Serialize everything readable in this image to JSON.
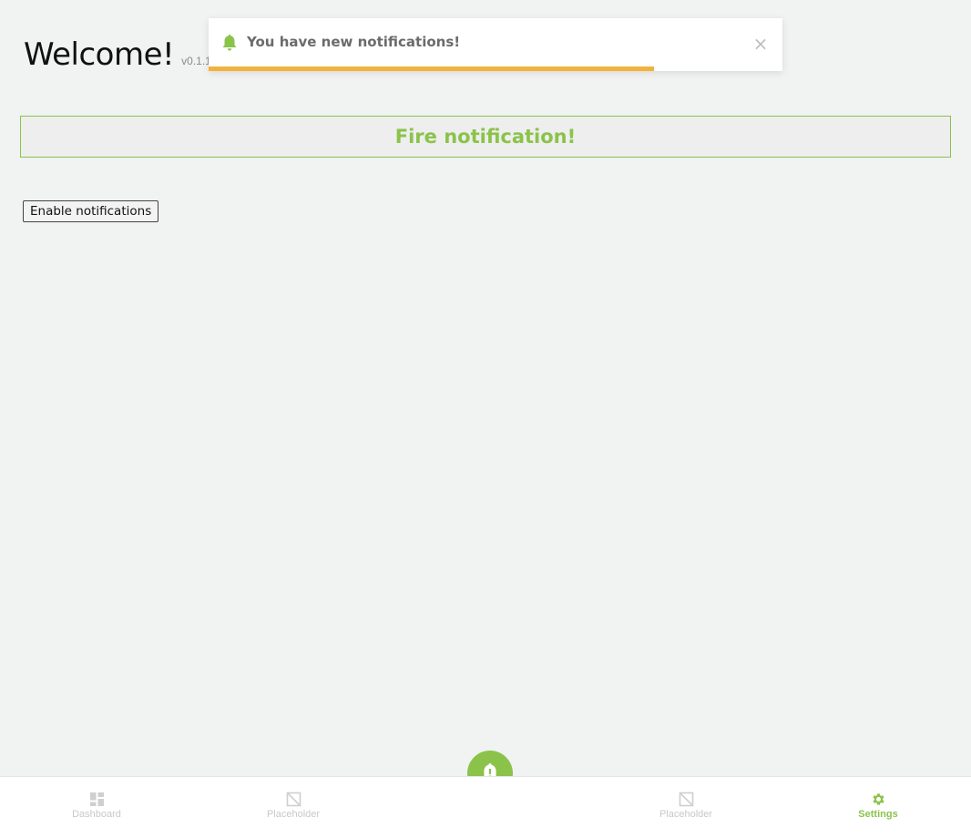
{
  "header": {
    "title": "Welcome!",
    "version": "v0.1.1"
  },
  "toast": {
    "message": "You have new notifications!",
    "icon": "bell-icon",
    "close_icon": "close-icon",
    "progress_fraction": 0.776
  },
  "main": {
    "fire_button_label": "Fire notification!",
    "enable_button_label": "Enable notifications"
  },
  "bottom_nav": {
    "items": [
      {
        "label": "Dashboard",
        "icon": "dashboard-icon",
        "active": false
      },
      {
        "label": "Placeholder",
        "icon": "placeholder-icon",
        "active": false
      },
      {
        "label": "Placeholder",
        "icon": "placeholder-icon",
        "active": false
      },
      {
        "label": "Settings",
        "icon": "gear-icon",
        "active": true
      }
    ],
    "fab_icon": "bell-alert-icon"
  },
  "colors": {
    "accent_green": "#8bc34a",
    "progress_orange": "#f2b23a",
    "background": "#f1f2f2"
  }
}
